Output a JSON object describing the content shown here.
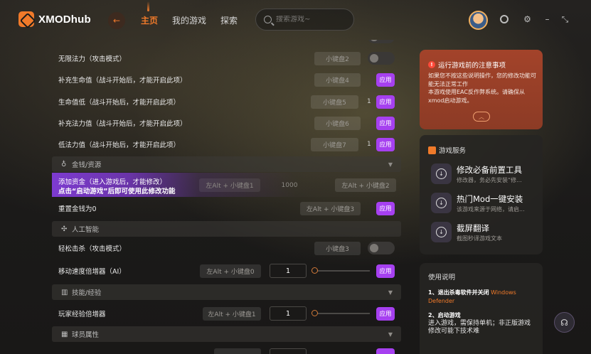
{
  "app": {
    "logo_text": "XMODhub"
  },
  "nav": {
    "items": [
      "主页",
      "我的游戏",
      "探索"
    ]
  },
  "search": {
    "placeholder": "搜索游戏~"
  },
  "mods": {
    "rows": [
      {
        "label": "无限法力（攻击模式）",
        "key": "小键盘2",
        "type": "toggle"
      },
      {
        "label": "补充生命值（战斗开始后，才能开启此项）",
        "key": "小键盘4",
        "type": "apply",
        "apply": "应用"
      },
      {
        "label": "生命值低（战斗开始后，才能开启此项）",
        "key": "小键盘5",
        "count": "1",
        "type": "apply",
        "apply": "应用"
      },
      {
        "label": "补充法力值（战斗开始后，才能开启此项）",
        "key": "小键盘6",
        "type": "apply",
        "apply": "应用"
      },
      {
        "label": "低法力值（战斗开始后，才能开启此项）",
        "key": "小键盘7",
        "count": "1",
        "type": "apply",
        "apply": "应用"
      }
    ],
    "sections": {
      "money": "金钱/资源",
      "ai": "人工智能",
      "skills": "技能/经验",
      "player": "球员属性"
    },
    "highlight": {
      "line1": "添加资金（进入游戏后，才能修改）",
      "line2": "点击“启动游戏”后即可使用此修改功能",
      "key1": "左Alt + 小键盘1",
      "value": "1000",
      "key2": "左Alt + 小键盘2"
    },
    "reset_money": {
      "label": "重置金钱为0",
      "key": "左Alt + 小键盘3",
      "apply": "应用"
    },
    "easy_kill": {
      "label": "轻松击杀（攻击模式）",
      "key": "小键盘3"
    },
    "ai_speed": {
      "label": "移动速度倍增器（AI）",
      "key": "左Alt + 小键盘0",
      "value": "1",
      "apply": "应用"
    },
    "xp_mult": {
      "label": "玩家经验倍增器",
      "key": "左Alt + 小键盘1",
      "value": "1",
      "apply": "应用"
    }
  },
  "notice": {
    "title": "运行游戏前的注意事项",
    "body": "如果您不按这些说明操作，您的修改功能可能无法正常工作\n本游戏使用EAC反作弊系统。请确保从xmod启动游戏。"
  },
  "services": {
    "title": "游戏服务",
    "items": [
      {
        "name": "修改必备前置工具",
        "desc": "修改器，务必先安装“修..."
      },
      {
        "name": "热门Mod一键安装",
        "desc": "该游戏来源于网络，请启..."
      },
      {
        "name": "截屏翻译",
        "desc": "截图秒译游戏文本"
      }
    ]
  },
  "usage": {
    "title": "使用说明",
    "item1_title": "1、退出杀毒软件并关闭",
    "item1_hl": "Windows Defender",
    "item2_title": "2、启动游戏",
    "item2_body": "进入游戏，需保持单机；非正版游戏修改可能下技术难"
  },
  "colors": {
    "accent": "#f07a2a",
    "apply": "#a640f0",
    "notice": "#a3432a"
  }
}
